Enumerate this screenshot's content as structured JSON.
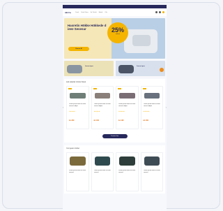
{
  "header": {
    "logo": "AB Fa",
    "nav": [
      "Yatak",
      "Yatak Odası",
      "Ev Tekstili",
      "Bebek",
      "Ofis"
    ]
  },
  "hero": {
    "title": "Hasretin Hökke Hökkede d ieee Sesesur",
    "badge_pct": "25%",
    "badge_sub": "indirim",
    "cta": "Hemen Al"
  },
  "promos": [
    {
      "text": "Lorem ipsu"
    },
    {
      "text": "Lorem ipsu"
    }
  ],
  "section1": {
    "title": "Çok satanlar ürünler listesi",
    "products": [
      {
        "name": "Lorem ipsum dolor sit amet consect adipis",
        "stars": "★★★★★",
        "price": "₺1.299",
        "color": "#6f7f78"
      },
      {
        "name": "Lorem ipsum dolor sit amet consect adipis",
        "stars": "★★★★★",
        "price": "₺1.499",
        "color": "#8a7f79"
      },
      {
        "name": "Lorem ipsum dolor sit amet consect adipis",
        "stars": "★★★★★",
        "price": "₺1.199",
        "color": "#7b6d74"
      },
      {
        "name": "Lorem ipsum dolor sit amet consect adipis",
        "stars": "★★★★★",
        "price": "₺1.399",
        "color": "#68717d"
      }
    ],
    "more_button": "Tümünü Gör"
  },
  "section2": {
    "title": "Yeni gelen ürünler",
    "products": [
      {
        "name": "Lorem ipsum dolor sit amet consect",
        "color": "#7b6a3c"
      },
      {
        "name": "Lorem ipsum dolor sit amet consect",
        "color": "#2f4a4e"
      },
      {
        "name": "Lorem ipsum dolor sit amet consect",
        "color": "#2e3e3a"
      },
      {
        "name": "Lorem ipsum dolor sit amet consect",
        "color": "#3e4c55"
      }
    ]
  }
}
